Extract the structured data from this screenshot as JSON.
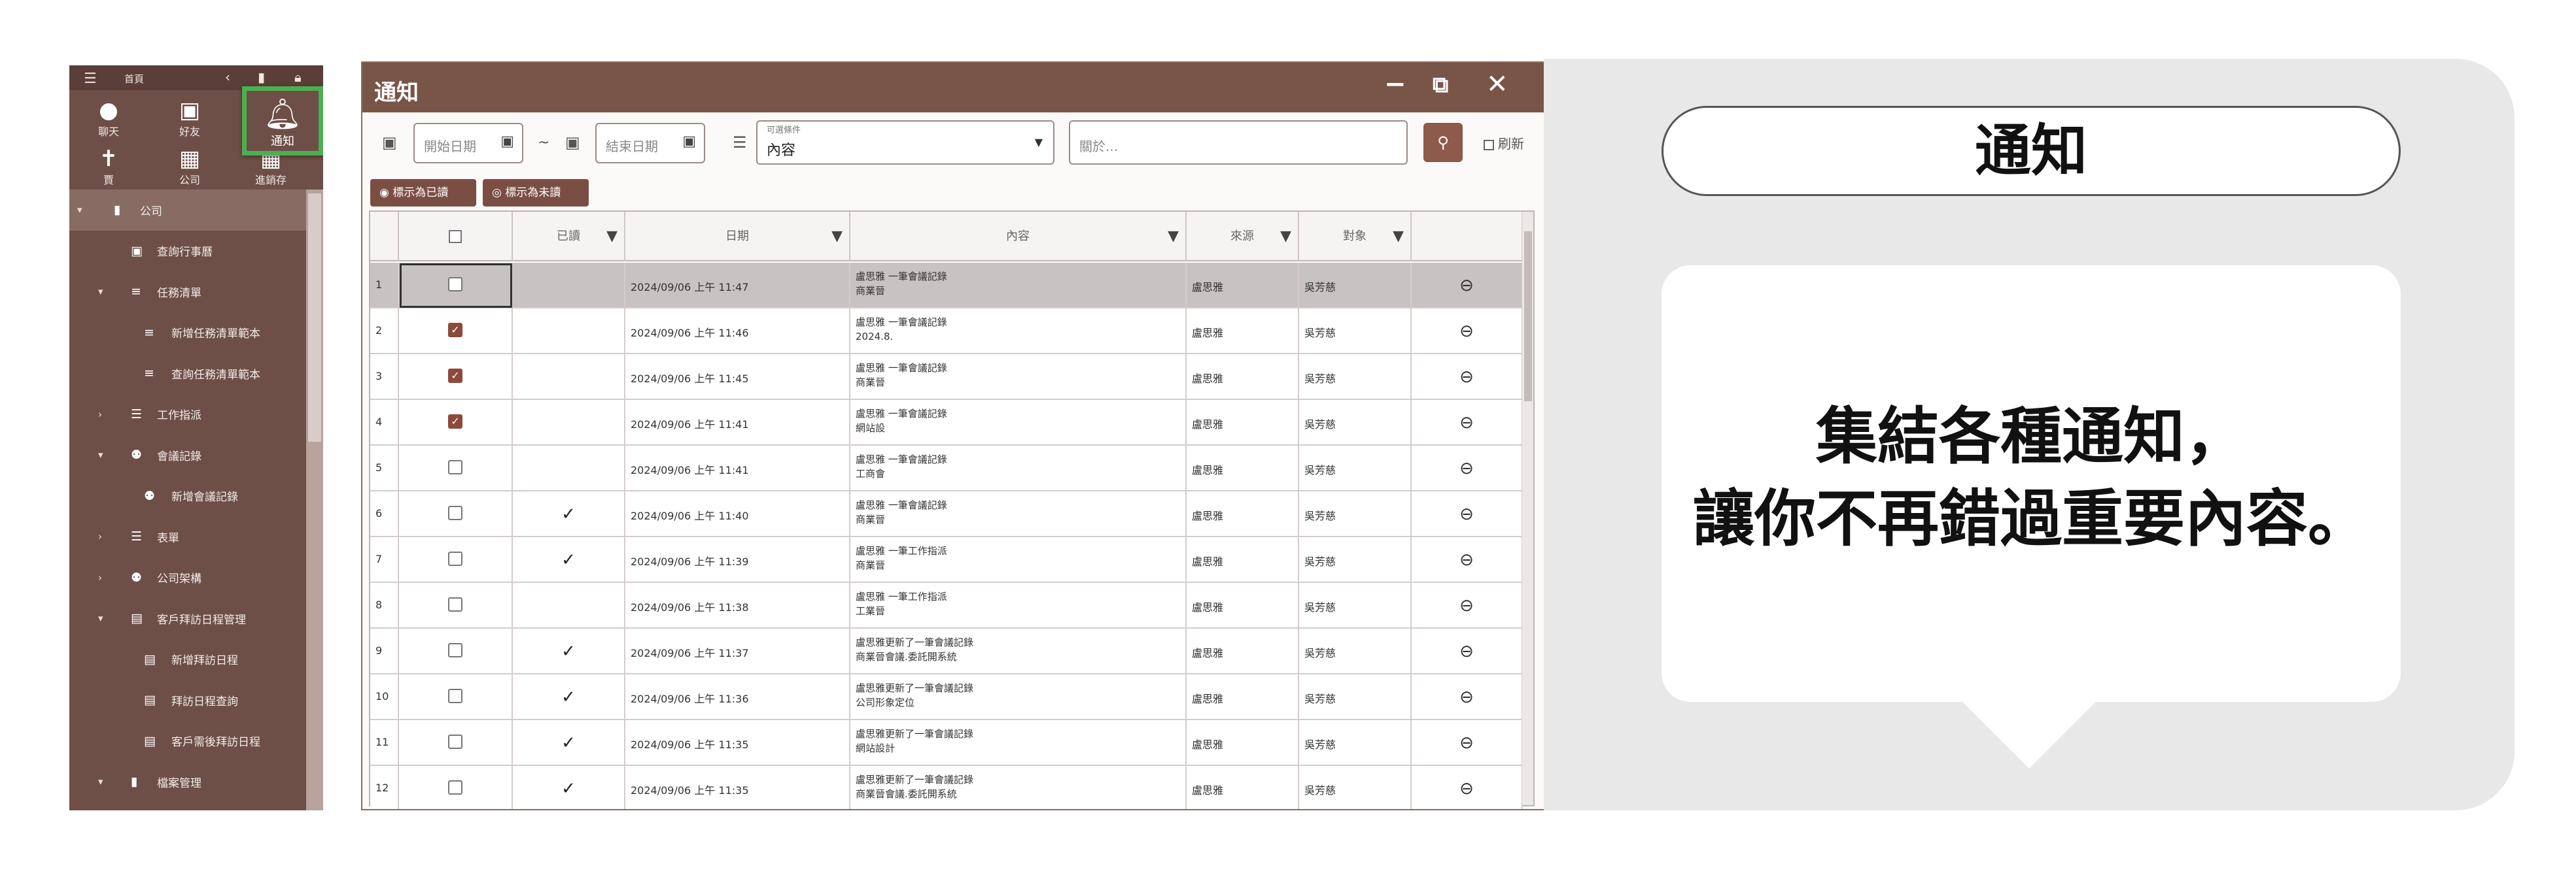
{
  "sidebar": {
    "top_label": "首頁",
    "tiles": [
      {
        "label": "聊天",
        "icon": "chat-icon"
      },
      {
        "label": "好友",
        "icon": "friend-icon"
      },
      {
        "label": "賈",
        "icon": "person-icon"
      },
      {
        "label": "公司",
        "icon": "company-icon"
      },
      {
        "label": "進銷存",
        "icon": "inventory-icon"
      }
    ],
    "notify_tile": {
      "label": "通知",
      "icon": "bell-icon"
    },
    "menu": [
      {
        "label": "公司",
        "icon": "building-icon",
        "arrow": "expanded"
      },
      {
        "label": "查詢行事曆",
        "icon": "calendar-icon"
      },
      {
        "label": "任務清單",
        "icon": "task-list-icon",
        "arrow": "expanded"
      },
      {
        "label": "新增任務清單範本",
        "icon": "task-list-icon"
      },
      {
        "label": "查詢任務清單範本",
        "icon": "task-list-icon"
      },
      {
        "label": "工作指派",
        "icon": "list-icon",
        "arrow": "collapsed"
      },
      {
        "label": "會議記錄",
        "icon": "people-icon",
        "arrow": "expanded"
      },
      {
        "label": "新增會議記錄",
        "icon": "people-icon"
      },
      {
        "label": "表單",
        "icon": "list-icon",
        "arrow": "collapsed"
      },
      {
        "label": "公司架構",
        "icon": "people-icon",
        "arrow": "collapsed"
      },
      {
        "label": "客戶拜訪日程管理",
        "icon": "book-icon",
        "arrow": "expanded"
      },
      {
        "label": "新增拜訪日程",
        "icon": "doc-edit-icon"
      },
      {
        "label": "拜訪日程查詢",
        "icon": "doc-search-icon"
      },
      {
        "label": "客戶需後拜訪日程",
        "icon": "doc-check-icon"
      },
      {
        "label": "檔案管理",
        "icon": "folder-icon",
        "arrow": "expanded"
      }
    ]
  },
  "window": {
    "title": "通知",
    "date_start_placeholder": "開始日期",
    "date_end_placeholder": "結束日期",
    "tilde": "~",
    "condition_label": "可選條件",
    "condition_value": "內容",
    "search_placeholder": "關於...",
    "refresh_label": "刷新",
    "mark_read_label": "標示為已讀",
    "mark_unread_label": "標示為未讀",
    "columns": [
      "",
      "已讀",
      "日期",
      "內容",
      "來源",
      "對象",
      ""
    ],
    "rows": [
      {
        "n": "1",
        "checked": false,
        "read": "",
        "date": "2024/09/06 上午 11:47",
        "content1": "盧思雅            一筆會議記錄",
        "content2": "商業晉",
        "src": "盧思雅",
        "tgt": "吳芳慈",
        "selected": true
      },
      {
        "n": "2",
        "checked": true,
        "read": "",
        "date": "2024/09/06 上午 11:46",
        "content1": "盧思雅            一筆會議記錄",
        "content2": "2024.8.",
        "src": "盧思雅",
        "tgt": "吳芳慈",
        "selected": false
      },
      {
        "n": "3",
        "checked": true,
        "read": "",
        "date": "2024/09/06 上午 11:45",
        "content1": "盧思雅            一筆會議記錄",
        "content2": "商業晉",
        "src": "盧思雅",
        "tgt": "吳芳慈",
        "selected": false
      },
      {
        "n": "4",
        "checked": true,
        "read": "",
        "date": "2024/09/06 上午 11:41",
        "content1": "盧思雅            一筆會議記錄",
        "content2": "網站設",
        "src": "盧思雅",
        "tgt": "吳芳慈",
        "selected": false
      },
      {
        "n": "5",
        "checked": false,
        "read": "",
        "date": "2024/09/06 上午 11:41",
        "content1": "盧思雅            一筆會議記錄",
        "content2": "工商會",
        "src": "盧思雅",
        "tgt": "吳芳慈",
        "selected": false
      },
      {
        "n": "6",
        "checked": false,
        "read": "✓",
        "date": "2024/09/06 上午 11:40",
        "content1": "盧思雅            一筆會議記錄",
        "content2": "商業晉",
        "src": "盧思雅",
        "tgt": "吳芳慈",
        "selected": false
      },
      {
        "n": "7",
        "checked": false,
        "read": "✓",
        "date": "2024/09/06 上午 11:39",
        "content1": "盧思雅            一筆工作指派",
        "content2": "商業晉",
        "src": "盧思雅",
        "tgt": "吳芳慈",
        "selected": false
      },
      {
        "n": "8",
        "checked": false,
        "read": "",
        "date": "2024/09/06 上午 11:38",
        "content1": "盧思雅            一筆工作指派",
        "content2": "工業晉",
        "src": "盧思雅",
        "tgt": "吳芳慈",
        "selected": false
      },
      {
        "n": "9",
        "checked": false,
        "read": "✓",
        "date": "2024/09/06 上午 11:37",
        "content1": "盧思雅更新了一筆會議記錄",
        "content2": "商業晉會議.委託開系統",
        "src": "盧思雅",
        "tgt": "吳芳慈",
        "selected": false
      },
      {
        "n": "10",
        "checked": false,
        "read": "✓",
        "date": "2024/09/06 上午 11:36",
        "content1": "盧思雅更新了一筆會議記錄",
        "content2": "公司形象定位",
        "src": "盧思雅",
        "tgt": "吳芳慈",
        "selected": false
      },
      {
        "n": "11",
        "checked": false,
        "read": "✓",
        "date": "2024/09/06 上午 11:35",
        "content1": "盧思雅更新了一筆會議記錄",
        "content2": "網站設計",
        "src": "盧思雅",
        "tgt": "吳芳慈",
        "selected": false
      },
      {
        "n": "12",
        "checked": false,
        "read": "✓",
        "date": "2024/09/06 上午 11:35",
        "content1": "盧思雅更新了一筆會議記錄",
        "content2": "商業晉會議.委託開系統",
        "src": "盧思雅",
        "tgt": "吳芳慈",
        "selected": false
      }
    ]
  },
  "panel": {
    "title": "通知",
    "line1": "集結各種通知，",
    "line2": "讓你不再錯過重要內容。"
  },
  "colors": {
    "sidebar_bg": "#6e4f47",
    "titlebar_bg": "#795548",
    "accent_button": "#8d5a4b",
    "highlight_border": "#4caf50",
    "checked_box": "#8d4a3a"
  }
}
